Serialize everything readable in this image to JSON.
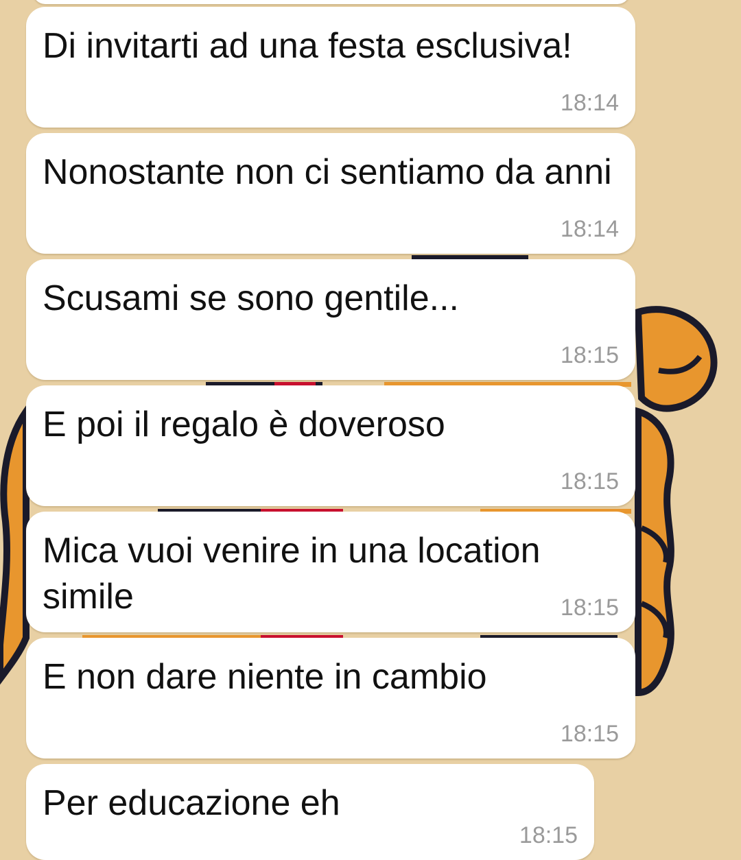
{
  "chat": {
    "messages": [
      {
        "text": "Di invitarti ad una festa esclusiva!",
        "time": "18:14"
      },
      {
        "text": "Nonostante non ci sentiamo da anni",
        "time": "18:14"
      },
      {
        "text": "Scusami se sono gentile...",
        "time": "18:15"
      },
      {
        "text": "E poi il regalo è doveroso",
        "time": "18:15"
      },
      {
        "text": "Mica vuoi venire in una location simile",
        "time": "18:15"
      },
      {
        "text": "E non dare niente in cambio",
        "time": "18:15"
      },
      {
        "text": "Per educazione eh",
        "time": "18:15"
      }
    ]
  },
  "colors": {
    "wallpaper": "#e8d0a4",
    "bubble": "#ffffff",
    "text": "#111111",
    "timestamp": "#9a9a9a",
    "cartoon_orange": "#e8962e",
    "cartoon_outline": "#1a1a2a",
    "cartoon_red": "#c8102e"
  }
}
